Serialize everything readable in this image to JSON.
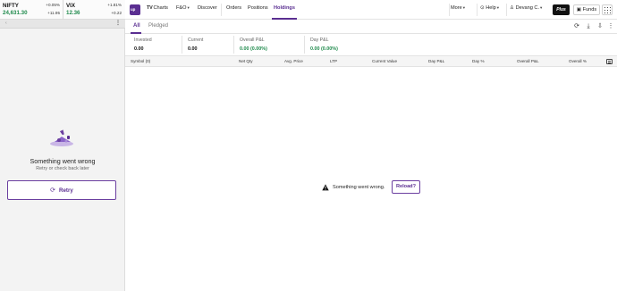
{
  "indices": [
    {
      "name": "NIFTY",
      "value": "24,631.30",
      "pct": "+0.05%",
      "abs": "+11.95"
    },
    {
      "name": "VIX",
      "value": "12.36",
      "pct": "+1.81%",
      "abs": "+0.22"
    }
  ],
  "left_error": {
    "title": "Something went wrong",
    "subtitle": "Retry or check back later",
    "retry_label": "Retry"
  },
  "nav": {
    "logo": "up",
    "charts_prefix": "TV",
    "charts": "Charts",
    "fno": "F&O",
    "discover": "Discover",
    "orders": "Orders",
    "positions": "Positions",
    "holdings": "Holdings",
    "more": "More",
    "help": "Help",
    "user": "Devang C.",
    "plus": "Plus",
    "funds": "Funds"
  },
  "tabs": {
    "all": "All",
    "pledged": "Pledged"
  },
  "summary": [
    {
      "label": "Invested",
      "value": "0.00"
    },
    {
      "label": "Current",
      "value": "0.00"
    },
    {
      "label": "Overall P&L",
      "value": "0.00 (0.00%)"
    },
    {
      "label": "Day P&L",
      "value": "0.00 (0.00%)"
    }
  ],
  "table_headers": {
    "symbol": "Symbol (0)",
    "net_qty": "Net Qty",
    "avg_price": "Avg. Price",
    "ltp": "LTP",
    "current_value": "Current Value",
    "day_pl": "Day P&L",
    "day_pct": "Day %",
    "overall_pl": "Overall P&L",
    "overall_pct": "Overall %"
  },
  "center_error": {
    "message": "Something went wrong.",
    "reload_label": "Reload?"
  },
  "colors": {
    "brand": "#5a2e91",
    "positive": "#1f8a4c"
  }
}
